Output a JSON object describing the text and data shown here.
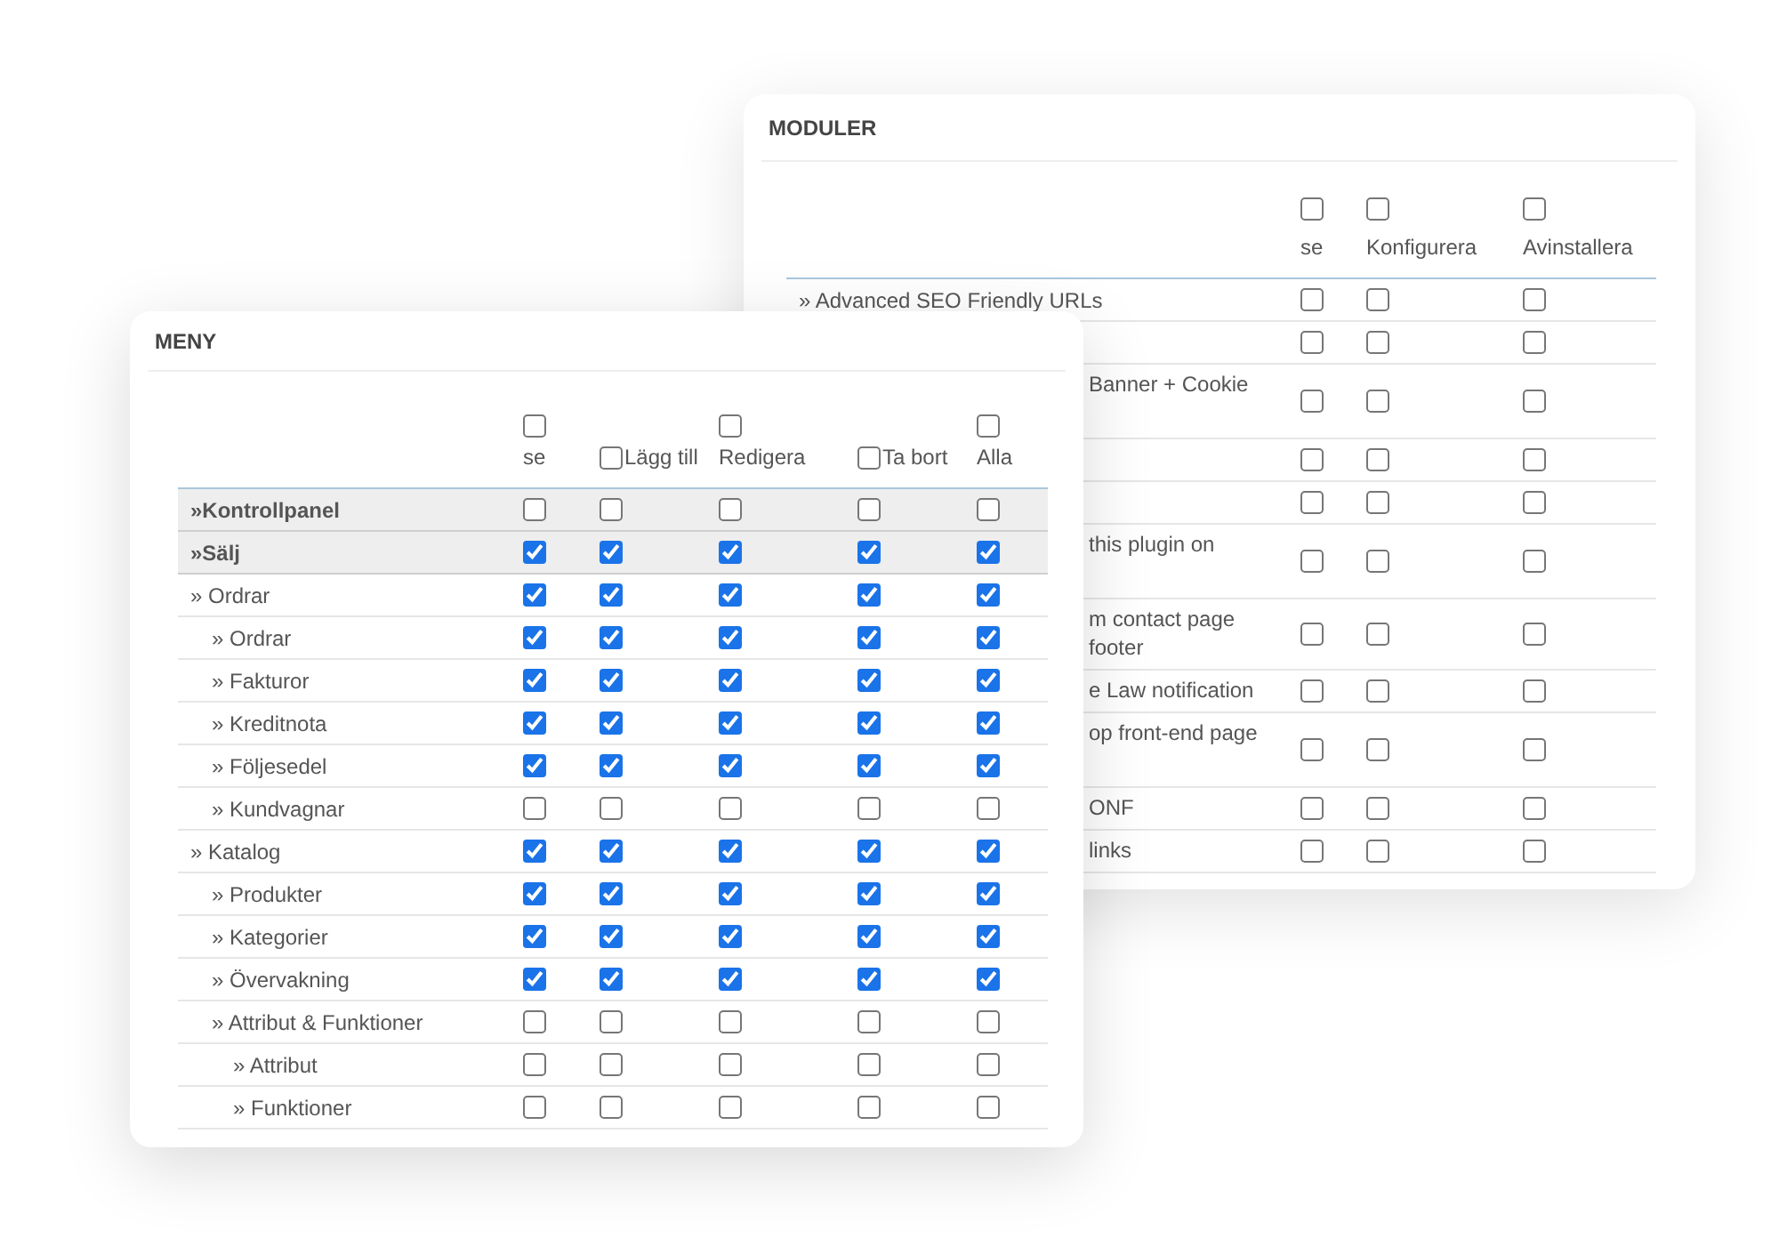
{
  "modules_panel": {
    "title": "MODULER",
    "columns": [
      {
        "label": "se",
        "checked": false
      },
      {
        "label": "Konfigurera",
        "checked": false
      },
      {
        "label": "Avinstallera",
        "checked": false
      }
    ],
    "rows": [
      {
        "label": "» Advanced SEO Friendly URLs",
        "checks": [
          false,
          false,
          false
        ]
      },
      {
        "checks": [
          false,
          false,
          false
        ]
      },
      {
        "label": "Banner + Cookie",
        "checks": [
          false,
          false,
          false
        ]
      },
      {
        "checks": [
          false,
          false,
          false
        ]
      },
      {
        "checks": [
          false,
          false,
          false
        ]
      },
      {
        "label": "this plugin on",
        "checks": [
          false,
          false,
          false
        ]
      },
      {
        "label": "m contact page\nfooter",
        "checks": [
          false,
          false,
          false
        ]
      },
      {
        "label": "e Law notification",
        "checks": [
          false,
          false,
          false
        ]
      },
      {
        "label": "op front-end page",
        "checks": [
          false,
          false,
          false
        ]
      },
      {
        "label": "ONF",
        "checks": [
          false,
          false,
          false
        ]
      },
      {
        "label": "links",
        "checks": [
          false,
          false,
          false
        ]
      }
    ]
  },
  "menu_panel": {
    "title": "MENY",
    "columns": [
      {
        "label": "se",
        "checked": false
      },
      {
        "label": "Lägg till",
        "checked": false
      },
      {
        "label": "Redigera",
        "checked": false
      },
      {
        "label": "Ta bort",
        "checked": false
      },
      {
        "label": "Alla",
        "checked": false
      }
    ],
    "items": [
      {
        "label": "»Kontrollpanel",
        "checks": [
          false,
          false,
          false,
          false,
          false
        ]
      },
      {
        "label": "»Sälj",
        "checks": [
          true,
          true,
          true,
          true,
          true
        ],
        "children": [
          {
            "label": "» Ordrar",
            "checks": [
              true,
              true,
              true,
              true,
              true
            ],
            "children": [
              {
                "label": "» Ordrar",
                "checks": [
                  true,
                  true,
                  true,
                  true,
                  true
                ]
              },
              {
                "label": "» Fakturor",
                "checks": [
                  true,
                  true,
                  true,
                  true,
                  true
                ]
              },
              {
                "label": "» Kreditnota",
                "checks": [
                  true,
                  true,
                  true,
                  true,
                  true
                ]
              },
              {
                "label": "» Följesedel",
                "checks": [
                  true,
                  true,
                  true,
                  true,
                  true
                ]
              },
              {
                "label": "» Kundvagnar",
                "checks": [
                  false,
                  false,
                  false,
                  false,
                  false
                ]
              }
            ]
          },
          {
            "label": "» Katalog",
            "checks": [
              true,
              true,
              true,
              true,
              true
            ],
            "children": [
              {
                "label": "» Produkter",
                "checks": [
                  true,
                  true,
                  true,
                  true,
                  true
                ]
              },
              {
                "label": "» Kategorier",
                "checks": [
                  true,
                  true,
                  true,
                  true,
                  true
                ]
              },
              {
                "label": "» Övervakning",
                "checks": [
                  true,
                  true,
                  true,
                  true,
                  true
                ]
              },
              {
                "label": "» Attribut & Funktioner",
                "checks": [
                  false,
                  false,
                  false,
                  false,
                  false
                ],
                "children": [
                  {
                    "label": "» Attribut",
                    "checks": [
                      false,
                      false,
                      false,
                      false,
                      false
                    ]
                  },
                  {
                    "label": "» Funktioner",
                    "checks": [
                      false,
                      false,
                      false,
                      false,
                      false
                    ]
                  }
                ]
              }
            ]
          }
        ]
      }
    ]
  }
}
